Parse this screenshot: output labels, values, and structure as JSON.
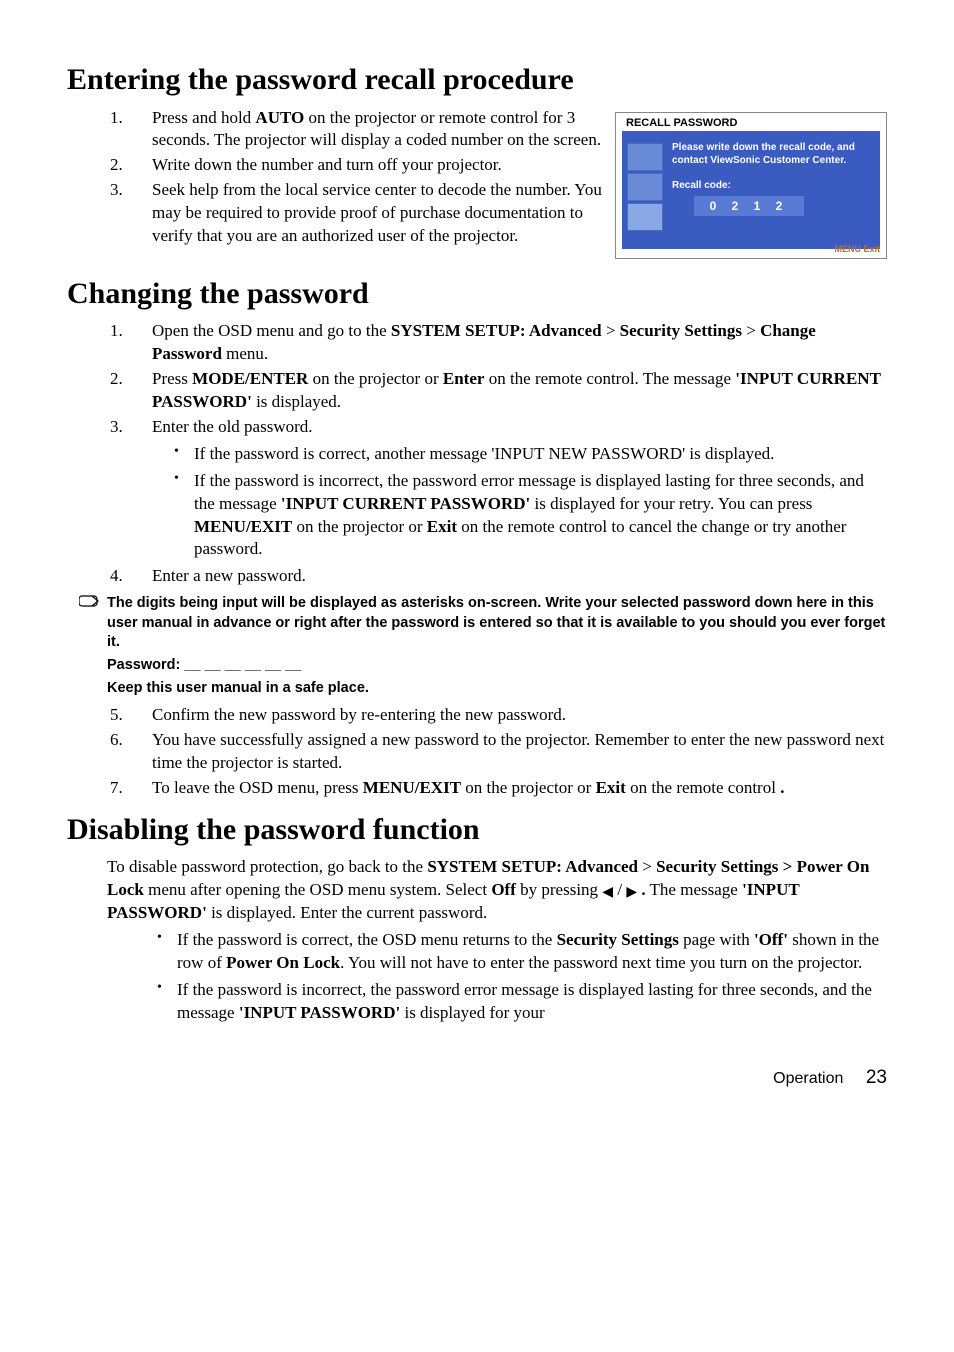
{
  "section1": {
    "heading": "Entering the password recall procedure",
    "items": [
      {
        "marker": "1.",
        "html": "Press and hold <b>AUTO</b> on the projector or remote control for 3 seconds. The projector will display a coded number on the screen."
      },
      {
        "marker": "2.",
        "html": "Write down the number and turn off your projector."
      },
      {
        "marker": "3.",
        "html": "Seek help from the local service center to decode the number. You may be required to provide proof of purchase documentation to verify that you are an authorized user of the projector."
      }
    ],
    "figure": {
      "title": "RECALL PASSWORD",
      "text": "Please write down the recall code, and contact ViewSonic Customer Center.",
      "label": "Recall code:",
      "code": "0 2 1 2",
      "exit": "MENU Exit"
    }
  },
  "section2": {
    "heading": "Changing the password",
    "items": [
      {
        "marker": "1.",
        "html": "Open the OSD menu and go to the <b>SYSTEM SETUP: Advanced</b> > <b>Security Settings</b> > <b>Change Password</b> menu."
      },
      {
        "marker": "2.",
        "html": "Press <b>MODE/ENTER</b> on the projector or <b>Enter</b> on the remote control. The message <b>'INPUT CURRENT PASSWORD'</b> is displayed."
      },
      {
        "marker": "3.",
        "html": "Enter the old password.",
        "sub": [
          "If the password is correct, another message 'INPUT NEW PASSWORD' is displayed.",
          "If the password is incorrect, the password error message is displayed lasting for three seconds, and the message <b>'INPUT CURRENT PASSWORD'</b> is displayed for your retry. You can press <b>MENU/EXIT</b> on the projector or <b>Exit</b> on the remote control to cancel the change or try another password."
        ]
      },
      {
        "marker": "4.",
        "html": "Enter a new password."
      }
    ],
    "note": [
      "The digits being input will be displayed as asterisks on-screen. Write your selected password down here in this user manual in advance or right after the password is entered so that it is available to you should you ever forget it.",
      "Password: __ __ __ __ __ __",
      "Keep this user manual in a safe place."
    ],
    "items2": [
      {
        "marker": "5.",
        "html": "Confirm the new password by re-entering the new password."
      },
      {
        "marker": "6.",
        "html": "You have successfully assigned a new password to the projector. Remember to enter the new password next time the projector is started."
      },
      {
        "marker": "7.",
        "html": "To leave the OSD menu, press <b>MENU/EXIT</b> on the projector or <b>Exit</b> on the remote control <b>.</b>"
      }
    ]
  },
  "section3": {
    "heading": "Disabling the password function",
    "body": "To disable password protection, go back to the <b>SYSTEM SETUP: Advanced</b> > <b>Security Settings > Power On Lock</b> menu after opening the OSD menu system. Select <b>Off</b> by pressing <span class='arrow'>◀</span> / <span class='arrow'>▶</span> <b>.</b> The message <b>'INPUT PASSWORD'</b> is displayed. Enter the current password.",
    "sub": [
      "If the password is correct, the OSD menu returns to the <b>Security Settings</b> page with <b>'Off'</b> shown in the row of <b>Power On Lock</b>. You will not have to enter the password next time you turn on the projector.",
      "If the password is incorrect, the password error message is displayed lasting for three seconds, and the message <b>'INPUT PASSWORD'</b> is displayed for your"
    ]
  },
  "footer": {
    "label": "Operation",
    "page": "23"
  }
}
